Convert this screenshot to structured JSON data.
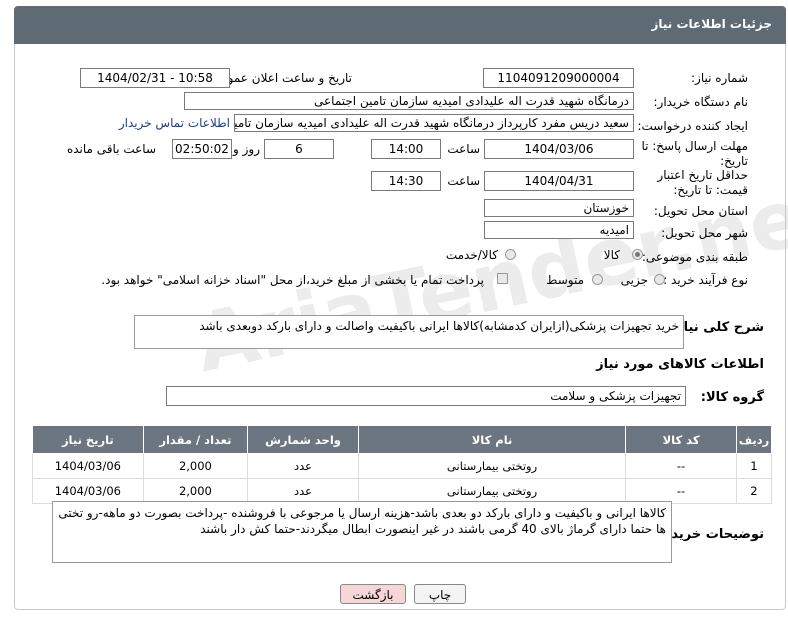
{
  "header": {
    "title": "جزئیات اطلاعات نیاز"
  },
  "fields": {
    "need_number_label": "شماره نیاز:",
    "need_number": "1104091209000004",
    "announce_label": "تاریخ و ساعت اعلان عمومی:",
    "announce_value": "1404/02/31 - 10:58",
    "buyer_org_label": "نام دستگاه خریدار:",
    "buyer_org": "درمانگاه شهید قدرت اله علیدادی امیدیه سازمان تامین اجتماعی",
    "creator_label": "ایجاد کننده درخواست:",
    "creator": "سعید دریس مفرد کارپرداز درمانگاه شهید قدرت اله علیدادی امیدیه سازمان تامین",
    "buyer_contact_link": "اطلاعات تماس خریدار",
    "reply_deadline_label": "مهلت ارسال پاسخ: تا تاریخ:",
    "reply_date": "1404/03/06",
    "time_label": "ساعت",
    "reply_time": "14:00",
    "days_value": "6",
    "days_label": "روز و",
    "remaining_time": "02:50:02",
    "remaining_label": "ساعت باقی مانده",
    "price_validity_label": "حداقل تاریخ اعتبار قیمت: تا تاریخ:",
    "validity_date": "1404/04/31",
    "validity_time_label": "ساعت",
    "validity_time": "14:30",
    "province_label": "استان محل تحویل:",
    "province": "خوزستان",
    "city_label": "شهر محل تحویل:",
    "city": "امیدیه",
    "category_label": "طبقه بندی موضوعی:",
    "category_goods": "کالا",
    "category_goods_service": "کالا/خدمت",
    "purchase_type_label": "نوع فرآیند خرید :",
    "purchase_partial": "جزیی",
    "purchase_medium": "متوسط",
    "payment_note": "پرداخت تمام یا بخشی از مبلغ خرید،از محل \"اسناد خزانه اسلامی\" خواهد بود."
  },
  "description": {
    "label": "شرح کلی نیاز:",
    "text": "خرید تجهیزات پزشکی(ازایران کدمشابه)کالاها ایرانی باکیفیت واصالت و دارای بارکد دوبعدی باشد"
  },
  "goods_section": {
    "title": "اطلاعات کالاهای مورد نیاز",
    "group_label": "گروه کالا:",
    "group_value": "تجهیزات پزشکی و سلامت"
  },
  "table": {
    "headers": [
      "ردیف",
      "کد کالا",
      "نام کالا",
      "واحد شمارش",
      "تعداد / مقدار",
      "تاریخ نیاز"
    ],
    "rows": [
      {
        "row": "1",
        "code": "--",
        "name": "روتختی بیمارستانی",
        "unit": "عدد",
        "qty": "2,000",
        "date": "1404/03/06"
      },
      {
        "row": "2",
        "code": "--",
        "name": "روتختی بیمارستانی",
        "unit": "عدد",
        "qty": "2,000",
        "date": "1404/03/06"
      }
    ]
  },
  "buyer_notes": {
    "label": "توضیحات خریدار:",
    "text": "کالاها ایرانی و باکیفیت و دارای بارکد دو بعدی باشد-هزینه ارسال یا مرجوعی با فروشنده -پرداخت بصورت دو ماهه-رو تختی ها حتما دارای گرماژ بالای 40 گرمی باشند در غیر اینصورت ابطال میگردند-حتما کش دار باشند"
  },
  "buttons": {
    "print": "چاپ",
    "back": "بازگشت"
  },
  "watermark": "AriaTender.net"
}
